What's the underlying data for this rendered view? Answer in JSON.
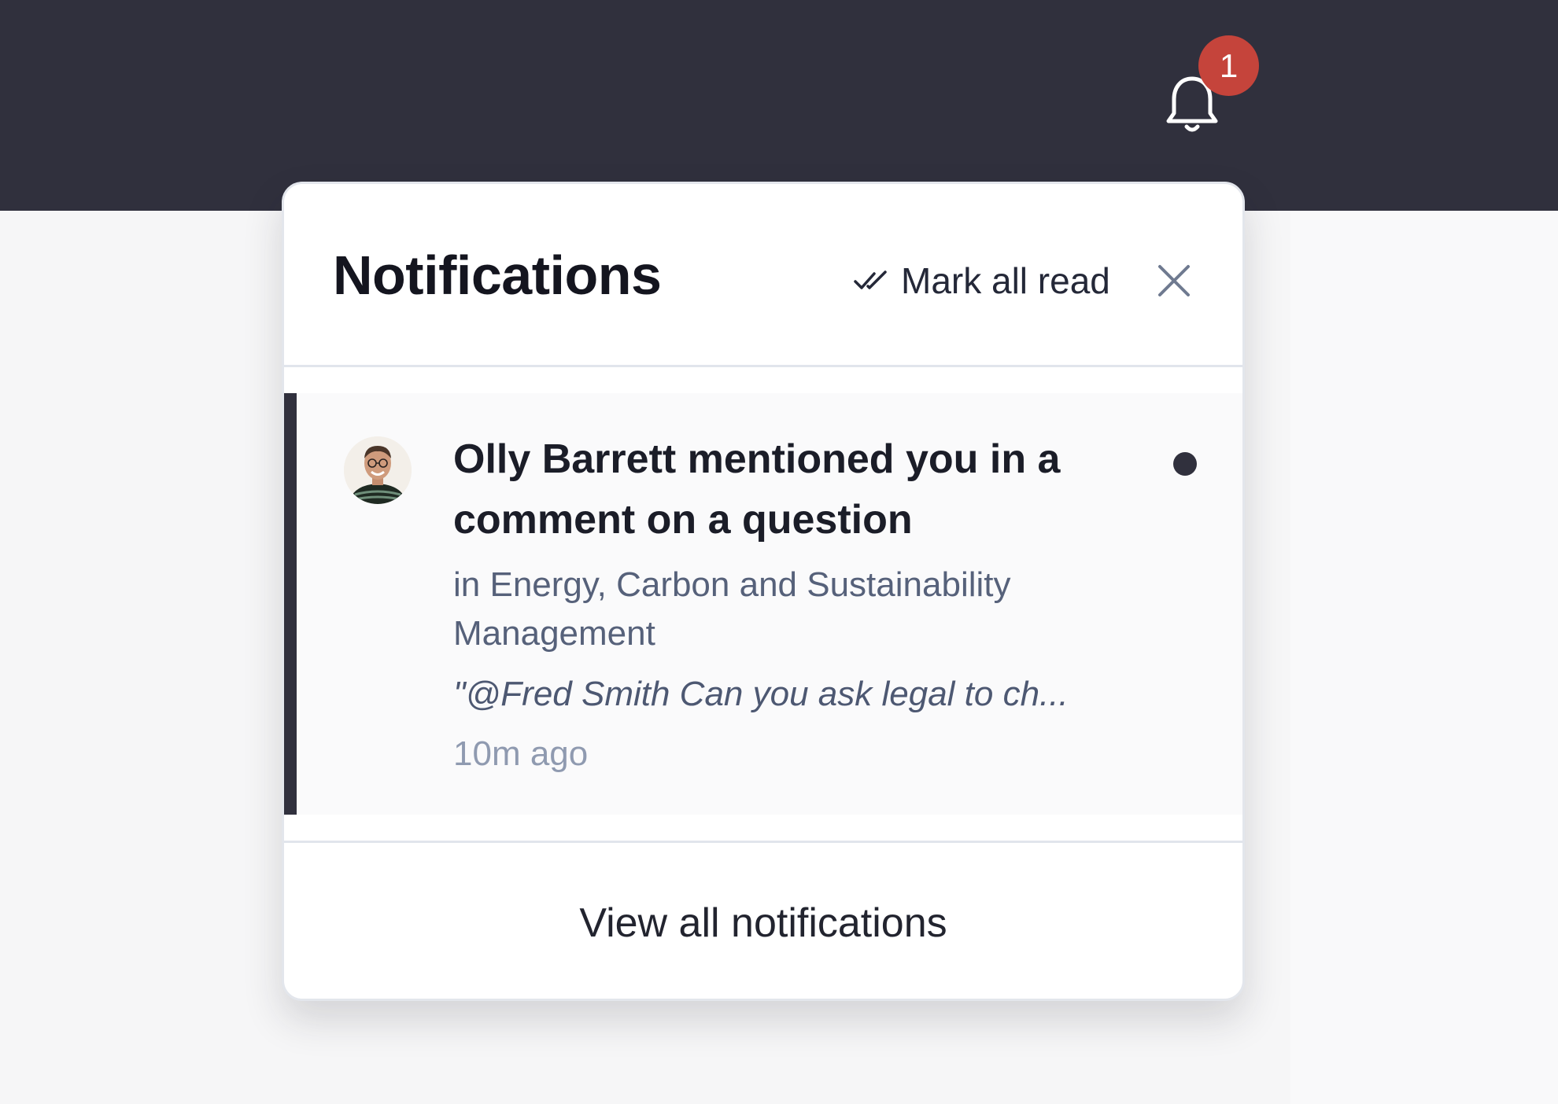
{
  "header": {
    "notification_count": "1"
  },
  "panel": {
    "title": "Notifications",
    "mark_all_read_label": "Mark all read",
    "close_icon": "close-icon",
    "mark_icon": "double-check-icon"
  },
  "notifications": [
    {
      "title": "Olly Barrett mentioned you in a comment on a question",
      "context": "in Energy, Carbon and Sustainability Management",
      "excerpt": "\"@Fred Smith Can you ask legal to ch...",
      "time": "10m ago",
      "unread": true
    }
  ],
  "footer": {
    "view_all_label": "View all notifications"
  },
  "colors": {
    "topbar": "#30303d",
    "badge": "#c5443b",
    "unread_indicator": "#30303d"
  }
}
